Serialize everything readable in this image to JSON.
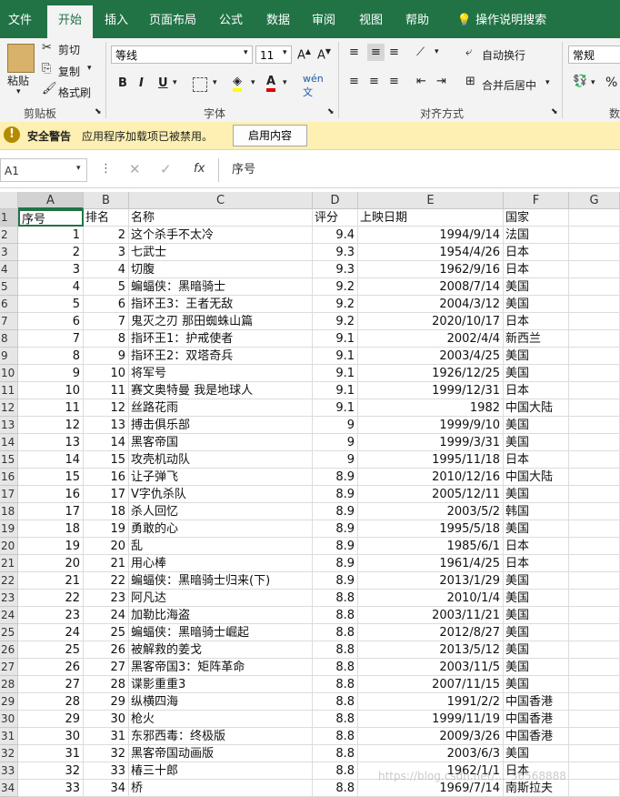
{
  "menu_tabs": [
    "文件",
    "开始",
    "插入",
    "页面布局",
    "公式",
    "数据",
    "审阅",
    "视图",
    "帮助",
    "操作说明搜索"
  ],
  "active_tab": "开始",
  "ribbon": {
    "clipboard": {
      "paste": "粘贴",
      "cut": "剪切",
      "copy": "复制",
      "format_painter": "格式刷",
      "group": "剪贴板"
    },
    "font": {
      "name": "等线",
      "size": "11",
      "bold": "B",
      "italic": "I",
      "underline": "U",
      "group": "字体"
    },
    "alignment": {
      "wrap": "自动换行",
      "merge": "合并后居中",
      "group": "对齐方式"
    },
    "number": {
      "format": "常规",
      "group": "数"
    }
  },
  "warning": {
    "title": "安全警告",
    "message": "应用程序加载项已被禁用。",
    "button": "启用内容"
  },
  "formula_bar": {
    "name_box": "A1",
    "content": "序号"
  },
  "columns": [
    "A",
    "B",
    "C",
    "D",
    "E",
    "F",
    "G"
  ],
  "header_row": [
    "序号",
    "排名",
    "名称",
    "评分",
    "上映日期",
    "国家"
  ],
  "rows": [
    [
      "1",
      "2",
      "这个杀手不太冷",
      "9.4",
      "1994/9/14",
      "法国"
    ],
    [
      "2",
      "3",
      "七武士",
      "9.3",
      "1954/4/26",
      "日本"
    ],
    [
      "3",
      "4",
      "切腹",
      "9.3",
      "1962/9/16",
      "日本"
    ],
    [
      "4",
      "5",
      "蝙蝠侠：黑暗骑士",
      "9.2",
      "2008/7/14",
      "美国"
    ],
    [
      "5",
      "6",
      "指环王3：王者无敌",
      "9.2",
      "2004/3/12",
      "美国"
    ],
    [
      "6",
      "7",
      "鬼灭之刃 那田蜘蛛山篇",
      "9.2",
      "2020/10/17",
      "日本"
    ],
    [
      "7",
      "8",
      "指环王1：护戒使者",
      "9.1",
      "2002/4/4",
      "新西兰"
    ],
    [
      "8",
      "9",
      "指环王2：双塔奇兵",
      "9.1",
      "2003/4/25",
      "美国"
    ],
    [
      "9",
      "10",
      "将军号",
      "9.1",
      "1926/12/25",
      "美国"
    ],
    [
      "10",
      "11",
      "赛文奥特曼 我是地球人",
      "9.1",
      "1999/12/31",
      "日本"
    ],
    [
      "11",
      "12",
      "丝路花雨",
      "9.1",
      "1982",
      "中国大陆"
    ],
    [
      "12",
      "13",
      "搏击俱乐部",
      "9",
      "1999/9/10",
      "美国"
    ],
    [
      "13",
      "14",
      "黑客帝国",
      "9",
      "1999/3/31",
      "美国"
    ],
    [
      "14",
      "15",
      "攻壳机动队",
      "9",
      "1995/11/18",
      "日本"
    ],
    [
      "15",
      "16",
      "让子弹飞",
      "8.9",
      "2010/12/16",
      "中国大陆"
    ],
    [
      "16",
      "17",
      "V字仇杀队",
      "8.9",
      "2005/12/11",
      "美国"
    ],
    [
      "17",
      "18",
      "杀人回忆",
      "8.9",
      "2003/5/2",
      "韩国"
    ],
    [
      "18",
      "19",
      "勇敢的心",
      "8.9",
      "1995/5/18",
      "美国"
    ],
    [
      "19",
      "20",
      "乱",
      "8.9",
      "1985/6/1",
      "日本"
    ],
    [
      "20",
      "21",
      "用心棒",
      "8.9",
      "1961/4/25",
      "日本"
    ],
    [
      "21",
      "22",
      "蝙蝠侠：黑暗骑士归来(下)",
      "8.9",
      "2013/1/29",
      "美国"
    ],
    [
      "22",
      "23",
      "阿凡达",
      "8.8",
      "2010/1/4",
      "美国"
    ],
    [
      "23",
      "24",
      "加勒比海盗",
      "8.8",
      "2003/11/21",
      "美国"
    ],
    [
      "24",
      "25",
      "蝙蝠侠：黑暗骑士崛起",
      "8.8",
      "2012/8/27",
      "美国"
    ],
    [
      "25",
      "26",
      "被解救的姜戈",
      "8.8",
      "2013/5/12",
      "美国"
    ],
    [
      "26",
      "27",
      "黑客帝国3：矩阵革命",
      "8.8",
      "2003/11/5",
      "美国"
    ],
    [
      "27",
      "28",
      "谍影重重3",
      "8.8",
      "2007/11/15",
      "美国"
    ],
    [
      "28",
      "29",
      "纵横四海",
      "8.8",
      "1991/2/2",
      "中国香港"
    ],
    [
      "29",
      "30",
      "枪火",
      "8.8",
      "1999/11/19",
      "中国香港"
    ],
    [
      "30",
      "31",
      "东邪西毒：终极版",
      "8.8",
      "2009/3/26",
      "中国香港"
    ],
    [
      "31",
      "32",
      "黑客帝国动画版",
      "8.8",
      "2003/6/3",
      "美国"
    ],
    [
      "32",
      "33",
      "椿三十郎",
      "8.8",
      "1962/1/1",
      "日本"
    ],
    [
      "33",
      "34",
      "桥",
      "8.8",
      "1969/7/14",
      "南斯拉夫"
    ]
  ],
  "watermark": "https://blog.csdn.net/..._36568888"
}
